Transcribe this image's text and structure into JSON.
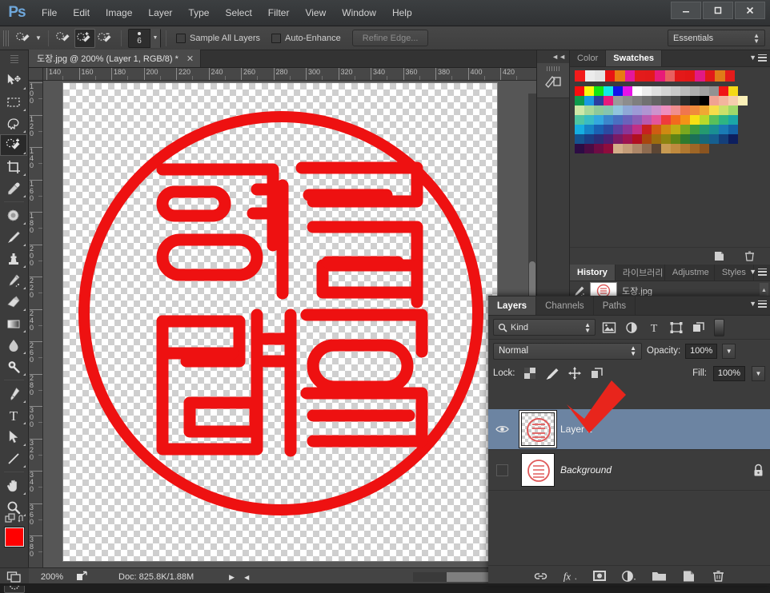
{
  "app": {
    "name": "Ps",
    "menus": [
      "File",
      "Edit",
      "Image",
      "Layer",
      "Type",
      "Select",
      "Filter",
      "View",
      "Window",
      "Help"
    ],
    "window_buttons": {
      "minimize": "—",
      "maximize": "❐",
      "close": "✕"
    }
  },
  "options_bar": {
    "tool_preset_icon": "quick-selection-preset-icon",
    "modes": [
      "new-selection",
      "add-to-selection",
      "subtract-from-selection"
    ],
    "active_mode_index": 1,
    "brush_size": "6",
    "checkboxes": [
      {
        "label": "Sample All Layers",
        "checked": false
      },
      {
        "label": "Auto-Enhance",
        "checked": false
      }
    ],
    "refine_edge_label": "Refine Edge...",
    "workspace": "Essentials"
  },
  "toolbar": {
    "tools": [
      {
        "name": "move-tool",
        "selected": false
      },
      {
        "name": "rectangular-marquee-tool",
        "selected": false
      },
      {
        "name": "lasso-tool",
        "selected": false
      },
      {
        "name": "quick-selection-tool",
        "selected": true
      },
      {
        "name": "crop-tool",
        "selected": false
      },
      {
        "name": "eyedropper-tool",
        "selected": false
      },
      {
        "name": "spot-healing-brush-tool",
        "selected": false
      },
      {
        "name": "brush-tool",
        "selected": false
      },
      {
        "name": "clone-stamp-tool",
        "selected": false
      },
      {
        "name": "history-brush-tool",
        "selected": false
      },
      {
        "name": "eraser-tool",
        "selected": false
      },
      {
        "name": "gradient-tool",
        "selected": false
      },
      {
        "name": "blur-tool",
        "selected": false
      },
      {
        "name": "dodge-tool",
        "selected": false
      },
      {
        "name": "pen-tool",
        "selected": false
      },
      {
        "name": "type-tool",
        "selected": false
      },
      {
        "name": "path-selection-tool",
        "selected": false
      },
      {
        "name": "line-tool",
        "selected": false
      },
      {
        "name": "hand-tool",
        "selected": false
      },
      {
        "name": "zoom-tool",
        "selected": false
      }
    ],
    "foreground_color": "#ff0000",
    "background_color": "#ffffff"
  },
  "document": {
    "tab_title": "도장.jpg @ 200% (Layer 1, RGB/8) *",
    "close_label": "✕",
    "ruler_h": [
      "140",
      "160",
      "180",
      "200",
      "220",
      "240",
      "260",
      "280",
      "300",
      "320",
      "340",
      "360",
      "380",
      "400",
      "420"
    ],
    "ruler_v": [
      "100",
      "120",
      "140",
      "160",
      "180",
      "200",
      "220",
      "240",
      "260",
      "280",
      "300",
      "320",
      "340",
      "360",
      "380"
    ],
    "artwork": {
      "name": "korean-seal-dojang",
      "stroke_color": "#ee1111",
      "description": "Red circular Korean name seal with stylized hangul characters"
    }
  },
  "status_bar": {
    "zoom": "200%",
    "doc_info": "Doc: 825.8K/1.88M"
  },
  "mini_dock": {
    "collapse_label": "◄◄",
    "items": [
      {
        "name": "tool-presets-icon"
      }
    ]
  },
  "color_panel": {
    "tabs": [
      {
        "label": "Color",
        "active": false
      },
      {
        "label": "Swatches",
        "active": true
      }
    ],
    "recent_colors": [
      "#f21b1b",
      "#ececec",
      "#e4e4e4",
      "#e81313",
      "#e87b12",
      "#e4189a",
      "#e31b1b",
      "#e21a1a",
      "#e81b78",
      "#e86060",
      "#e31919",
      "#e21717",
      "#e21a84",
      "#e21919",
      "#e07a18",
      "#e31b1b"
    ],
    "swatch_rows": [
      [
        "#fa0d0d",
        "#f9f90d",
        "#13e613",
        "#12e8e8",
        "#1212e8",
        "#e812e8",
        "#ffffff",
        "#ededed",
        "#e0e0e0",
        "#d4d4d4",
        "#c8c8c8",
        "#bbbbbb",
        "#aeaeae",
        "#a0a0a0",
        "#929292",
        "#f01515",
        "#f5d916"
      ],
      [
        "#0f9b4c",
        "#1b9ae0",
        "#2b3f9e",
        "#e81a7b",
        "#9a9a9a",
        "#8d8d8d",
        "#7f7f7f",
        "#717171",
        "#636363",
        "#555555",
        "#474747",
        "#2a2a2a",
        "#151515",
        "#000000",
        "#f0a292",
        "#f3b59d",
        "#f6cdae",
        "#fbf0b8"
      ],
      [
        "#cfe8a8",
        "#a8d89a",
        "#8ec99a",
        "#86c5b0",
        "#92c4dd",
        "#8fa8d6",
        "#9d9ad6",
        "#b095d2",
        "#cd93cd",
        "#ee8fbe",
        "#f08e8e",
        "#f0764e",
        "#f08b3c",
        "#f0a833",
        "#f5dd4a",
        "#cbe06a",
        "#9fd86a"
      ],
      [
        "#4fc5a2",
        "#39bcc4",
        "#34a8de",
        "#3c86cb",
        "#4a6fc1",
        "#6a62bb",
        "#8a5fb6",
        "#b85ab0",
        "#e4559a",
        "#ef3b3b",
        "#f26a1e",
        "#f59317",
        "#f7e014",
        "#b8d92a",
        "#59c05b",
        "#2eb583",
        "#1ba7a7"
      ],
      [
        "#15aee0",
        "#1684c6",
        "#1a61b3",
        "#2b4aa1",
        "#5c3fa0",
        "#8a3597",
        "#c02f86",
        "#c82020",
        "#d05c12",
        "#cf8a12",
        "#bfae14",
        "#7ba81e",
        "#3f9c3f",
        "#249a70",
        "#1a8f93",
        "#1a7bb5",
        "#1463a6"
      ],
      [
        "#14538f",
        "#1b3d84",
        "#2a2d78",
        "#4b1f72",
        "#7a1a64",
        "#9e1450",
        "#b01020",
        "#a8460e",
        "#9c6c0e",
        "#8c8310",
        "#5e8416",
        "#2e7a2e",
        "#1b7057",
        "#16697a",
        "#165f8f",
        "#143f7a",
        "#0d1f5e"
      ],
      [
        "#2c0c44",
        "#4a0c44",
        "#6e0c44",
        "#8e0c3c",
        "#d4ae89",
        "#c49d79",
        "#ad8768",
        "#8d6b50",
        "#5c4634",
        "#c79a52",
        "#c08a3e",
        "#b07830",
        "#9e6626",
        "#8a5420"
      ]
    ],
    "footer_icons": [
      "new-swatch-icon",
      "delete-swatch-icon"
    ]
  },
  "history_panel": {
    "tabs": [
      {
        "label": "History",
        "active": true
      },
      {
        "label": "라이브러리",
        "active": false
      },
      {
        "label": "Adjustme",
        "active": false
      },
      {
        "label": "Styles",
        "active": false
      }
    ],
    "entries": [
      {
        "label": "도장.jpg",
        "icon": "history-snapshot-icon"
      }
    ]
  },
  "layers_panel": {
    "tabs": [
      {
        "label": "Layers",
        "active": true
      },
      {
        "label": "Channels",
        "active": false
      },
      {
        "label": "Paths",
        "active": false
      }
    ],
    "filter": {
      "search_icon": "search-icon",
      "kind_label": "Kind",
      "filter_icons": [
        "pixel-layer-filter-icon",
        "adjustment-layer-filter-icon",
        "type-layer-filter-icon",
        "shape-layer-filter-icon",
        "smart-object-filter-icon"
      ],
      "toggle_name": "filter-toggle-switch"
    },
    "blend_mode": "Normal",
    "opacity_label": "Opacity:",
    "opacity_value": "100%",
    "lock_label": "Lock:",
    "lock_icons": [
      "lock-transparent-pixels-icon",
      "lock-image-pixels-icon",
      "lock-position-icon",
      "lock-artboard-icon"
    ],
    "fill_label": "Fill:",
    "fill_value": "100%",
    "layers": [
      {
        "name": "Layer 1",
        "selected": true,
        "visible": true,
        "locked": false,
        "italic": false,
        "thumb": "checker"
      },
      {
        "name": "Background",
        "selected": false,
        "visible": false,
        "locked": true,
        "italic": true,
        "thumb": "white"
      }
    ],
    "footer_icons": [
      "link-layers-icon",
      "layer-style-fx-icon",
      "add-layer-mask-icon",
      "new-adjustment-layer-icon",
      "new-group-icon",
      "new-layer-icon",
      "delete-layer-icon"
    ]
  },
  "annotation": {
    "name": "red-check-arrow-annotation",
    "color": "#e8251c"
  }
}
